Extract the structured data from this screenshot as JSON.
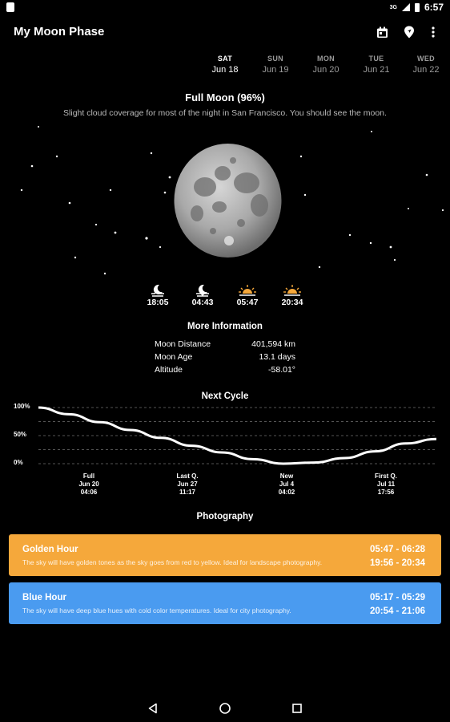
{
  "status_bar": {
    "network": "3G",
    "time": "6:57"
  },
  "app": {
    "title": "My Moon Phase"
  },
  "toolbar": {
    "icons": [
      "calendar-icon",
      "location-pin-icon",
      "more-vert-icon"
    ]
  },
  "days": [
    {
      "name": "SAT",
      "date": "Jun 18",
      "active": true
    },
    {
      "name": "SUN",
      "date": "Jun 19",
      "active": false
    },
    {
      "name": "MON",
      "date": "Jun 20",
      "active": false
    },
    {
      "name": "TUE",
      "date": "Jun 21",
      "active": false
    },
    {
      "name": "WED",
      "date": "Jun 22",
      "active": false
    }
  ],
  "phase": {
    "title": "Full Moon (96%)",
    "description": "Slight cloud coverage for most of the night in San Francisco. You should see the moon."
  },
  "times": [
    {
      "icon": "moonrise-icon",
      "time": "18:05"
    },
    {
      "icon": "moonset-icon",
      "time": "04:43"
    },
    {
      "icon": "sunrise-icon",
      "time": "05:47"
    },
    {
      "icon": "sunset-icon",
      "time": "20:34"
    }
  ],
  "more_info": {
    "title": "More Information",
    "rows": [
      {
        "label": "Moon Distance",
        "value": "401,594 km"
      },
      {
        "label": "Moon Age",
        "value": "13.1 days"
      },
      {
        "label": "Altitude",
        "value": "-58.01°"
      }
    ]
  },
  "next_cycle": {
    "title": "Next Cycle",
    "y_labels": [
      "100%",
      "50%",
      "0%"
    ],
    "phases": [
      {
        "name": "Full",
        "date": "Jun 20",
        "time": "04:06"
      },
      {
        "name": "Last Q.",
        "date": "Jun 27",
        "time": "11:17"
      },
      {
        "name": "New",
        "date": "Jul 4",
        "time": "04:02"
      },
      {
        "name": "First Q.",
        "date": "Jul 11",
        "time": "17:56"
      }
    ]
  },
  "chart_data": {
    "type": "line",
    "title": "Next Cycle",
    "xlabel": "",
    "ylabel": "",
    "ylim": [
      0,
      100
    ],
    "y_ticks": [
      "100%",
      "50%",
      "0%"
    ],
    "x_categories": [
      "Full Jun 20 04:06",
      "Last Q. Jun 27 11:17",
      "New Jul 4 04:02",
      "First Q. Jul 11 17:56"
    ],
    "series": [
      {
        "values": [
          100,
          88,
          74,
          60,
          46,
          32,
          20,
          8,
          0,
          2,
          10,
          22,
          36,
          44
        ]
      }
    ],
    "grid": true
  },
  "photography": {
    "title": "Photography",
    "cards": [
      {
        "title": "Golden Hour",
        "description": "The sky will have golden tones as the sky goes from red to yellow. Ideal for landscape photography.",
        "morning": "05:47 - 06:28",
        "evening": "19:56 - 20:34",
        "color": "#F5A83B"
      },
      {
        "title": "Blue Hour",
        "description": "The sky will have deep blue hues with cold color temperatures. Ideal for city photography.",
        "morning": "05:17 - 05:29",
        "evening": "20:54 - 21:06",
        "color": "#4A9BF0"
      }
    ]
  },
  "nav": {
    "icons": [
      "back-icon",
      "home-icon",
      "recents-icon"
    ]
  }
}
